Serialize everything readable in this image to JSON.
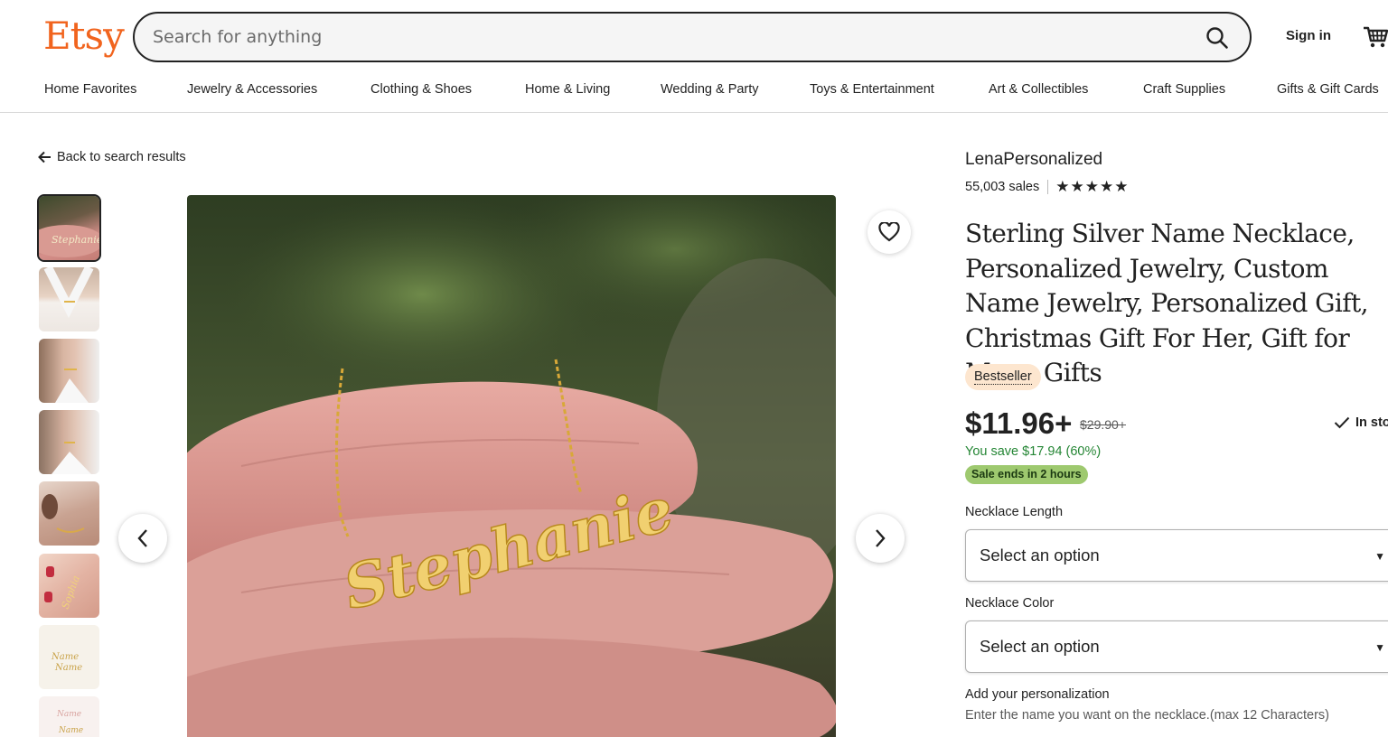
{
  "header": {
    "logo": "Etsy",
    "search_placeholder": "Search for anything",
    "sign_in": "Sign in"
  },
  "nav": {
    "items": [
      "Home Favorites",
      "Jewelry & Accessories",
      "Clothing & Shoes",
      "Home & Living",
      "Wedding & Party",
      "Toys & Entertainment",
      "Art & Collectibles",
      "Craft Supplies",
      "Gifts & Gift Cards"
    ]
  },
  "gallery": {
    "back_label": "Back to search results",
    "thumbnail_count": 8,
    "active_thumbnail": 1,
    "image_text": "Stephanie"
  },
  "listing": {
    "shop_name": "LenaPersonalized",
    "sales": "55,003 sales",
    "rating_stars": "★★★★★",
    "rating_value": 5,
    "title": "Sterling Silver Name Necklace, Personalized Jewelry, Custom Name Jewelry, Personalized Gift, Christmas Gift For Her, Gift for Mom, Gifts",
    "badge": "Bestseller",
    "price": "$11.96+",
    "original_price": "$29.90+",
    "stock": "In sto",
    "savings": "You save $17.94 (60%)",
    "sale_note": "Sale ends in 2 hours",
    "options": [
      {
        "label": "Necklace Length",
        "value": "Select an option"
      },
      {
        "label": "Necklace Color",
        "value": "Select an option"
      }
    ],
    "personalization_label": "Add your personalization",
    "personalization_help": "Enter the name you want on the necklace.(max 12 Characters)"
  },
  "colors": {
    "brand": "#f1641e",
    "savings_green": "#258635",
    "sale_badge": "#9ec96f",
    "bestseller_badge": "#fde6cf"
  }
}
